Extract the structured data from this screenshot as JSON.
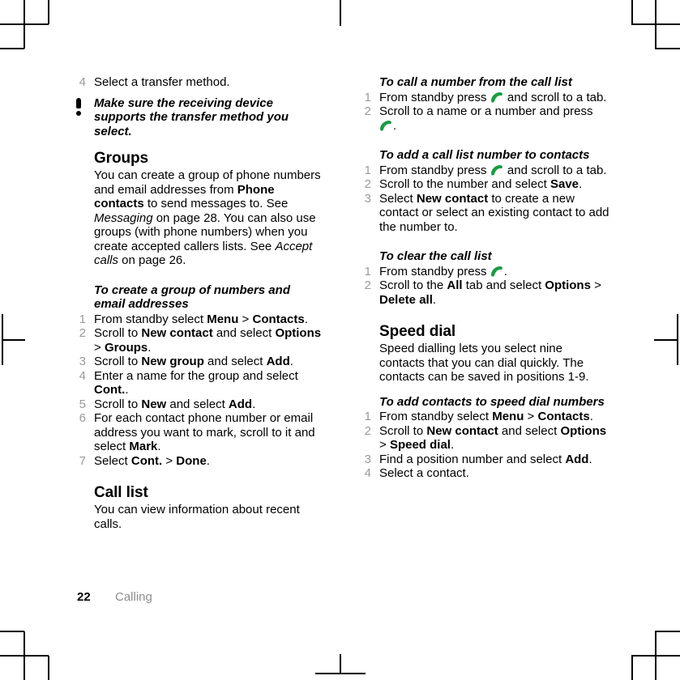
{
  "document": {
    "page_number": "22",
    "chapter": "Calling",
    "handset_icon_color": "#1a9c42",
    "step_number_color": "#9a9a9a",
    "chapter_text_color": "#8d8d8d"
  },
  "left_column": {
    "lead_step": {
      "num": "4",
      "text": "Select a transfer method."
    },
    "note": "Make sure the receiving device supports the transfer method you select.",
    "groups": {
      "heading": "Groups",
      "body_1": "You can create a group of phone numbers and email addresses from ",
      "body_bold_1": "Phone contacts",
      "body_2": " to send messages to. See ",
      "body_italic_1": "Messaging",
      "body_3": " on page 28. You can also use groups (with phone numbers) when you create accepted callers lists. See ",
      "body_italic_2": "Accept calls",
      "body_4": " on page 26."
    },
    "create_group": {
      "heading": "To create a group of numbers and email addresses",
      "steps": [
        {
          "num": "1",
          "parts": [
            {
              "t": "From standby select "
            },
            {
              "t": "Menu",
              "b": true
            },
            {
              "t": " > "
            },
            {
              "t": "Contacts",
              "b": true
            },
            {
              "t": "."
            }
          ]
        },
        {
          "num": "2",
          "parts": [
            {
              "t": "Scroll to "
            },
            {
              "t": "New contact",
              "b": true
            },
            {
              "t": " and select "
            },
            {
              "t": "Options",
              "b": true
            },
            {
              "t": " > "
            },
            {
              "t": "Groups",
              "b": true
            },
            {
              "t": "."
            }
          ]
        },
        {
          "num": "3",
          "parts": [
            {
              "t": "Scroll to "
            },
            {
              "t": "New group",
              "b": true
            },
            {
              "t": " and select "
            },
            {
              "t": "Add",
              "b": true
            },
            {
              "t": "."
            }
          ]
        },
        {
          "num": "4",
          "parts": [
            {
              "t": "Enter a name for the group and select "
            },
            {
              "t": "Cont.",
              "b": true
            },
            {
              "t": "."
            }
          ]
        },
        {
          "num": "5",
          "parts": [
            {
              "t": "Scroll to "
            },
            {
              "t": "New",
              "b": true
            },
            {
              "t": " and select "
            },
            {
              "t": "Add",
              "b": true
            },
            {
              "t": "."
            }
          ]
        },
        {
          "num": "6",
          "parts": [
            {
              "t": "For each contact phone number or email address you want to mark, scroll to it and select "
            },
            {
              "t": "Mark",
              "b": true
            },
            {
              "t": "."
            }
          ]
        },
        {
          "num": "7",
          "parts": [
            {
              "t": "Select "
            },
            {
              "t": "Cont.",
              "b": true
            },
            {
              "t": " > "
            },
            {
              "t": "Done",
              "b": true
            },
            {
              "t": "."
            }
          ]
        }
      ]
    },
    "call_list": {
      "heading": "Call list",
      "body": "You can view information about recent calls."
    }
  },
  "right_column": {
    "call_from_list": {
      "heading": "To call a number from the call list",
      "steps": [
        {
          "num": "1",
          "parts": [
            {
              "t": "From standby press "
            },
            {
              "icon": "call-handset-icon"
            },
            {
              "t": " and scroll to a tab."
            }
          ]
        },
        {
          "num": "2",
          "parts": [
            {
              "t": "Scroll to a name or a number and press "
            },
            {
              "icon": "call-handset-icon"
            },
            {
              "t": "."
            }
          ]
        }
      ]
    },
    "add_to_contacts": {
      "heading": "To add a call list number to contacts",
      "steps": [
        {
          "num": "1",
          "parts": [
            {
              "t": "From standby press "
            },
            {
              "icon": "call-handset-icon"
            },
            {
              "t": " and scroll to a tab."
            }
          ]
        },
        {
          "num": "2",
          "parts": [
            {
              "t": "Scroll to the number and select "
            },
            {
              "t": "Save",
              "b": true
            },
            {
              "t": "."
            }
          ]
        },
        {
          "num": "3",
          "parts": [
            {
              "t": "Select "
            },
            {
              "t": "New contact",
              "b": true
            },
            {
              "t": " to create a new contact or select an existing contact to add the number to."
            }
          ]
        }
      ]
    },
    "clear_call_list": {
      "heading": "To clear the call list",
      "steps": [
        {
          "num": "1",
          "parts": [
            {
              "t": "From standby press "
            },
            {
              "icon": "call-handset-icon"
            },
            {
              "t": "."
            }
          ]
        },
        {
          "num": "2",
          "parts": [
            {
              "t": "Scroll to the "
            },
            {
              "t": "All",
              "b": true
            },
            {
              "t": " tab and select "
            },
            {
              "t": "Options",
              "b": true
            },
            {
              "t": " > "
            },
            {
              "t": "Delete all",
              "b": true
            },
            {
              "t": "."
            }
          ]
        }
      ]
    },
    "speed_dial": {
      "heading": "Speed dial",
      "body": "Speed dialling lets you select nine contacts that you can dial quickly. The contacts can be saved in positions 1-9.",
      "sub_heading": "To add contacts to speed dial numbers",
      "steps": [
        {
          "num": "1",
          "parts": [
            {
              "t": "From standby select "
            },
            {
              "t": "Menu",
              "b": true
            },
            {
              "t": " > "
            },
            {
              "t": "Contacts",
              "b": true
            },
            {
              "t": "."
            }
          ]
        },
        {
          "num": "2",
          "parts": [
            {
              "t": "Scroll to "
            },
            {
              "t": "New contact",
              "b": true
            },
            {
              "t": " and select "
            },
            {
              "t": "Options",
              "b": true
            },
            {
              "t": " > "
            },
            {
              "t": "Speed dial",
              "b": true
            },
            {
              "t": "."
            }
          ]
        },
        {
          "num": "3",
          "parts": [
            {
              "t": "Find a position number and select "
            },
            {
              "t": "Add",
              "b": true
            },
            {
              "t": "."
            }
          ]
        },
        {
          "num": "4",
          "parts": [
            {
              "t": "Select a contact."
            }
          ]
        }
      ]
    }
  }
}
